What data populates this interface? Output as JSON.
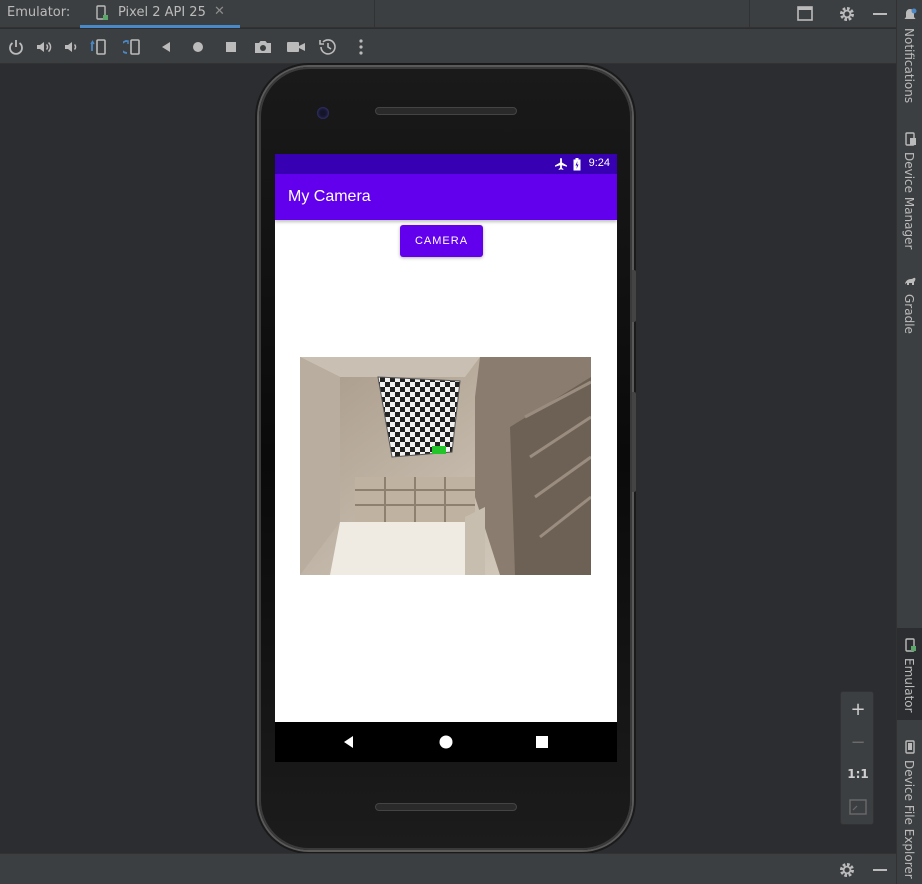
{
  "tabbar": {
    "label": "Emulator:",
    "tab_label": "Pixel 2 API 25",
    "close_glyph": "✕"
  },
  "toolbar": {
    "icons": [
      "power-icon",
      "volume-up-icon",
      "volume-down-icon",
      "rotate-left-icon",
      "rotate-right-icon",
      "back-icon",
      "home-icon",
      "overview-icon",
      "screenshot-icon",
      "screen-record-icon",
      "snapshot-icon",
      "more-icon"
    ]
  },
  "device": {
    "status_time": "9:24",
    "app_title": "My Camera",
    "camera_button": "CAMERA"
  },
  "sidebar": {
    "top_tabs": [
      "Notifications",
      "Device Manager",
      "Gradle"
    ],
    "bottom_tabs": [
      "Emulator",
      "Device File Explorer"
    ]
  },
  "zoom": {
    "plus": "+",
    "minus": "−",
    "one_to_one": "1:1"
  },
  "colors": {
    "accent": "#4a88c7",
    "status_bar": "#3700b3",
    "app_bar": "#6200ee"
  }
}
